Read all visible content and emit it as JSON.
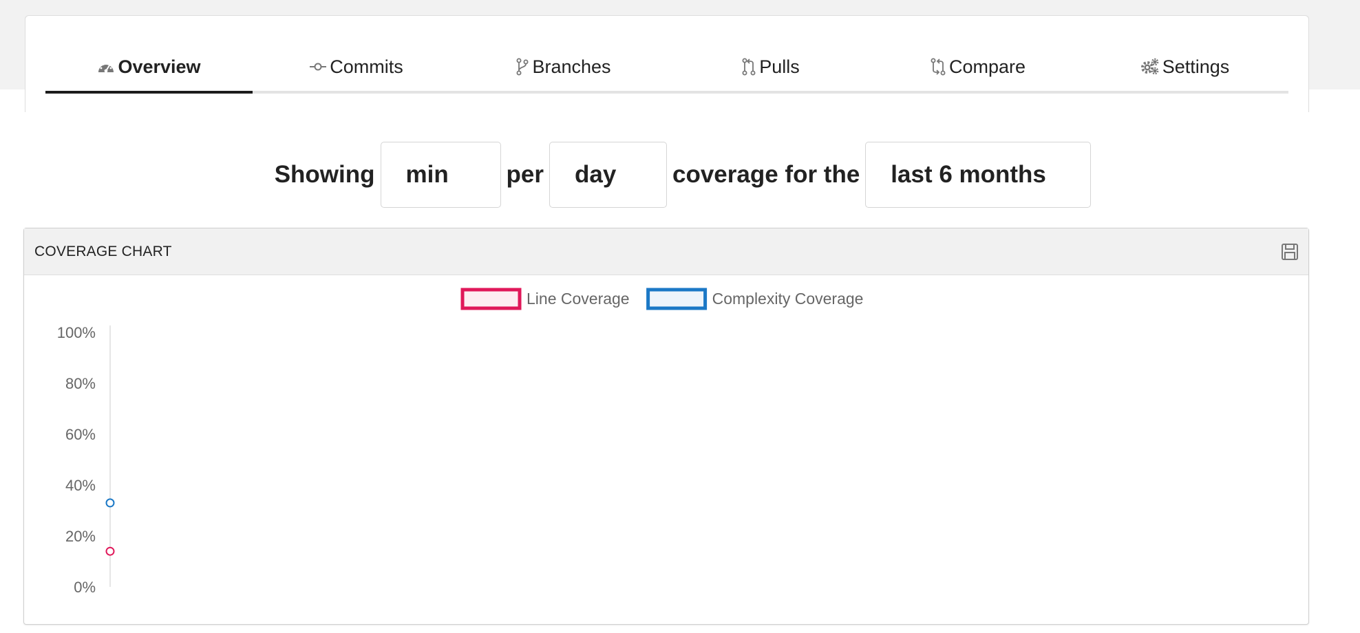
{
  "nav": {
    "tabs": [
      {
        "label": "Overview",
        "icon": "dashboard-icon",
        "active": true
      },
      {
        "label": "Commits",
        "icon": "commit-icon",
        "active": false
      },
      {
        "label": "Branches",
        "icon": "branch-icon",
        "active": false
      },
      {
        "label": "Pulls",
        "icon": "pull-request-icon",
        "active": false
      },
      {
        "label": "Compare",
        "icon": "compare-icon",
        "active": false
      },
      {
        "label": "Settings",
        "icon": "gears-icon",
        "active": false
      }
    ]
  },
  "filter": {
    "prefix": "Showing",
    "aggregate": "min",
    "per": "per",
    "interval": "day",
    "coverage_for": "coverage for the",
    "range": "last 6 months"
  },
  "panel": {
    "title": "COVERAGE CHART",
    "save_icon": "floppy-disk-icon"
  },
  "chart_data": {
    "type": "line",
    "title": "",
    "xlabel": "",
    "ylabel": "",
    "ylim": [
      0,
      100
    ],
    "y_ticks": [
      "100%",
      "80%",
      "60%",
      "40%",
      "20%",
      "0%"
    ],
    "legend_position": "top-center",
    "series": [
      {
        "name": "Line Coverage",
        "color": "#e0185a",
        "values": [
          14
        ]
      },
      {
        "name": "Complexity Coverage",
        "color": "#1b78c6",
        "values": [
          33
        ]
      }
    ]
  }
}
